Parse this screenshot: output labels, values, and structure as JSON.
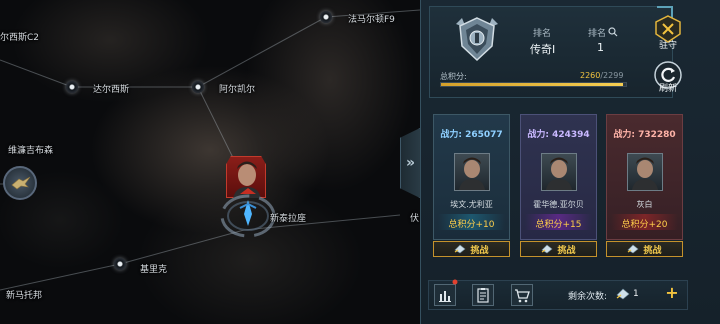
{
  "map": {
    "systems": [
      {
        "id": "aerxisi",
        "label": "尔西斯C2"
      },
      {
        "id": "famaerdun",
        "label": "法马尔顿F9"
      },
      {
        "id": "daerxisi",
        "label": "达尔西斯"
      },
      {
        "id": "aerkaier",
        "label": "阿尔凯尔"
      },
      {
        "id": "weilianjibusen",
        "label": "维濂吉布森"
      },
      {
        "id": "xintailazuo",
        "label": "新泰拉座"
      },
      {
        "id": "jilike",
        "label": "基里克"
      },
      {
        "id": "xinmatuobang",
        "label": "新马托邦"
      },
      {
        "id": "fu",
        "label": "伏"
      }
    ]
  },
  "panel": {
    "rank_header": "排名",
    "rank_header_2": "排名",
    "rank_value": "传奇Ⅰ",
    "rank_number": "1",
    "score_label": "总积分:",
    "score_current": "2260",
    "score_max": "/2299",
    "score_fraction": 0.983,
    "garrison_label": "驻守",
    "refresh_label": "刷新",
    "opponents": [
      {
        "power_label": "战力:",
        "power": "265077",
        "name": "埃文.尤利亚",
        "bonus": "总积分+10",
        "challenge": "挑战"
      },
      {
        "power_label": "战力:",
        "power": "424394",
        "name": "霍华德.亚尔贝",
        "bonus": "总积分+15",
        "challenge": "挑战"
      },
      {
        "power_label": "战力:",
        "power": "732280",
        "name": "灰白",
        "bonus": "总积分+20",
        "challenge": "挑战"
      }
    ],
    "remaining_label": "剩余次数:",
    "remaining_count": "1"
  },
  "colors": {
    "accent_gold": "#f2c33f",
    "panel_bg": "#15212a",
    "card_blue": "#1d3140",
    "card_purple": "#2a2c48",
    "card_red": "#3c2328"
  }
}
